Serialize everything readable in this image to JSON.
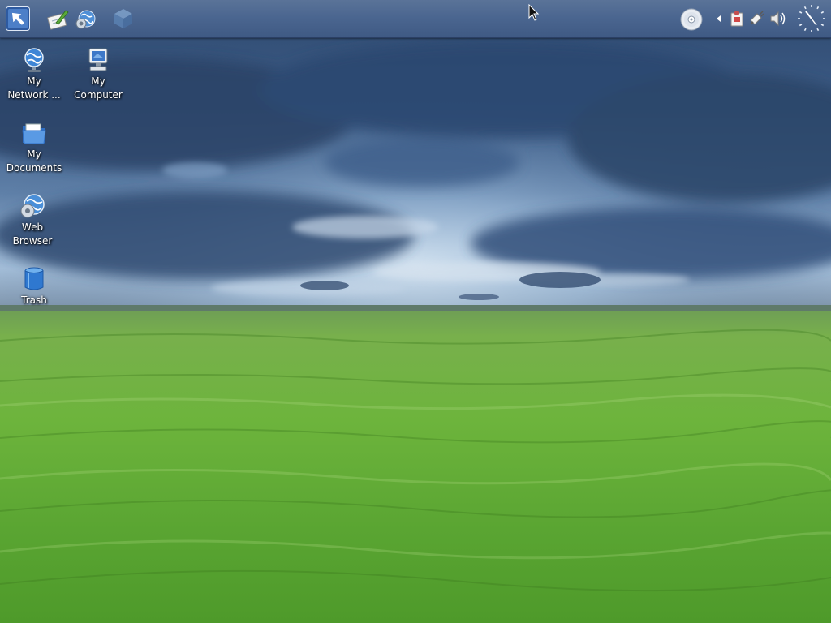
{
  "desktop": {
    "icons": [
      {
        "label": "My\nNetwork ...",
        "icon": "network-globe-icon"
      },
      {
        "label": "My\nComputer",
        "icon": "computer-monitor-icon"
      },
      {
        "label": "My\nDocuments",
        "icon": "documents-folder-icon"
      },
      {
        "label": "Web\nBrowser",
        "icon": "web-browser-globe-icon"
      },
      {
        "label": "Trash",
        "icon": "trash-can-icon"
      }
    ]
  },
  "panel": {
    "launchers": [
      {
        "icon": "application-menu-icon"
      },
      {
        "icon": "text-editor-icon"
      },
      {
        "icon": "web-browser-icon"
      },
      {
        "icon": "desktop-cube-icon"
      }
    ],
    "tray": [
      {
        "icon": "cd-drive-icon"
      },
      {
        "icon": "tray-expand-arrow-icon"
      },
      {
        "icon": "clipboard-icon"
      },
      {
        "icon": "network-plug-icon"
      },
      {
        "icon": "volume-speaker-icon"
      },
      {
        "icon": "analog-clock-icon"
      }
    ]
  },
  "colors": {
    "panel": "#4b6690",
    "sky_dark": "#2b4468",
    "sky_light": "#9bb8d6",
    "grass_light": "#7cc24a",
    "grass_dark": "#3f8a22"
  }
}
